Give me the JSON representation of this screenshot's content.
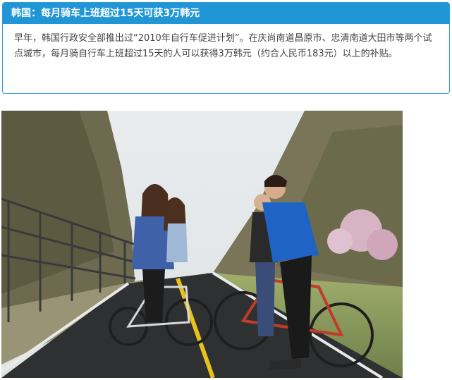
{
  "article": {
    "title": "韩国：每月骑车上班超过15天可获3万韩元",
    "body": "早年，韩国行政安全部推出过“2010年自行车促进计划”。在庆尚南道昌原市、忠清南道大田市等两个试点城市，每月骑自行车上班超过15天的人可以获得3万韩元（约合人民币183元）以上的补贴。"
  },
  "colors": {
    "accent": "#2196d6",
    "border": "#2a9ad8",
    "text": "#444444"
  },
  "photo": {
    "icon": "photo-cyclists-on-bike-path"
  }
}
